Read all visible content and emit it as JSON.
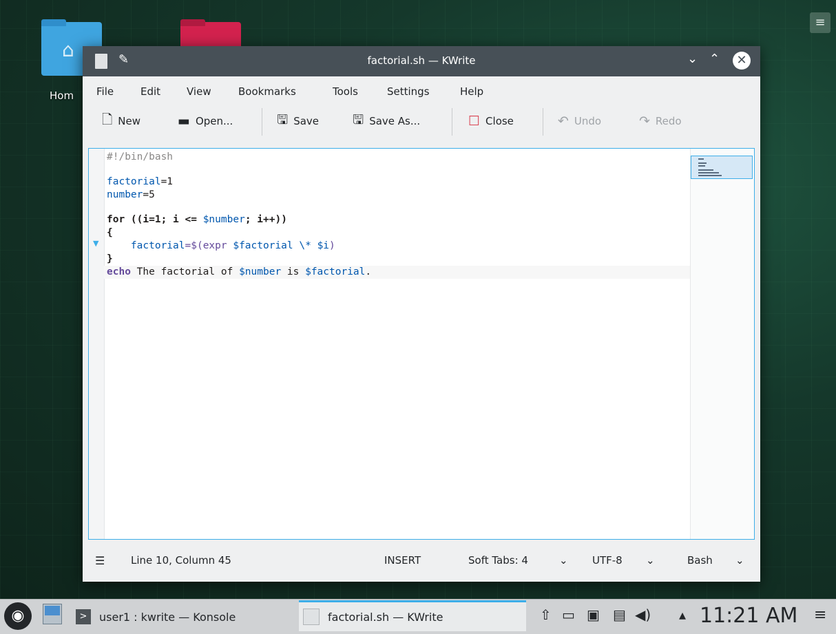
{
  "desktop": {
    "home_label": "Hom",
    "menu_icon": "hamburger-icon"
  },
  "window": {
    "title": "factorial.sh — KWrite"
  },
  "menubar": [
    "File",
    "Edit",
    "View",
    "Bookmarks",
    "Tools",
    "Settings",
    "Help"
  ],
  "toolbar": {
    "new": "New",
    "open": "Open...",
    "save": "Save",
    "save_as": "Save As...",
    "close": "Close",
    "undo": "Undo",
    "redo": "Redo"
  },
  "editor": {
    "lines": {
      "shebang": "#!/bin/bash",
      "l3_var": "factorial",
      "l3_rest": "=1",
      "l4_var": "number",
      "l4_rest": "=5",
      "l6_kw": "for",
      "l6_a": " ((i=1; i <= ",
      "l6_var": "$number",
      "l6_b": "; i++))",
      "l7": "{",
      "l8_indent": "    ",
      "l8_var": "factorial",
      "l8_sub": "=$(expr ",
      "l8_v1": "$factorial",
      "l8_mid": " \\* ",
      "l8_v2": "$i",
      "l8_end": ")",
      "l9": "}",
      "l10_kw": "echo",
      "l10_a": " The factorial of ",
      "l10_v1": "$number",
      "l10_b": " is ",
      "l10_v2": "$factorial",
      "l10_c": "."
    }
  },
  "statusbar": {
    "position": "Line 10, Column 45",
    "mode": "INSERT",
    "tabs": "Soft Tabs: 4",
    "encoding": "UTF-8",
    "syntax": "Bash"
  },
  "taskbar": {
    "task1": "user1 : kwrite — Konsole",
    "task2": "factorial.sh  — KWrite",
    "clock": "11:21 AM"
  },
  "colors": {
    "accent": "#3daee9",
    "titlebar": "#475057"
  }
}
